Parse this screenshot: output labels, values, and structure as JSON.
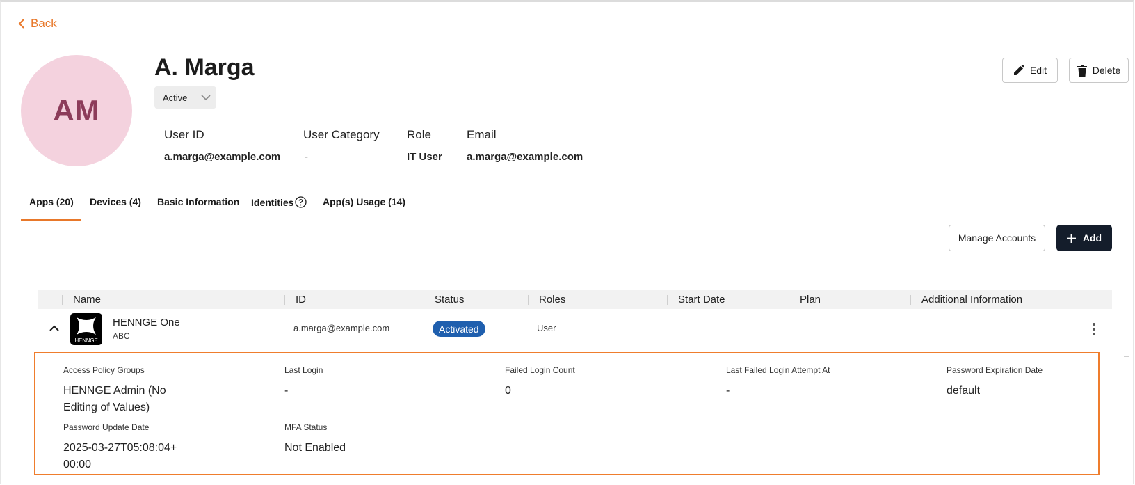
{
  "nav": {
    "back_label": "Back"
  },
  "user": {
    "initials": "AM",
    "name": "A. Marga",
    "status": "Active",
    "avatar_color": "#f4d2de",
    "avatar_text_color": "#8c3c5a"
  },
  "actions": {
    "edit_label": "Edit",
    "delete_label": "Delete"
  },
  "meta": [
    {
      "label": "User ID",
      "value": "a.marga@example.com"
    },
    {
      "label": "User Category",
      "value": "-"
    },
    {
      "label": "Role",
      "value": "IT User"
    },
    {
      "label": "Email",
      "value": "a.marga@example.com"
    }
  ],
  "tabs": [
    {
      "label": "Apps (20)",
      "active": true
    },
    {
      "label": "Devices (4)"
    },
    {
      "label": "Basic Information"
    },
    {
      "label": "Identities",
      "icon": "help-circle-icon"
    },
    {
      "label": "App(s) Usage (14)"
    }
  ],
  "toolbar": {
    "manage_label": "Manage Accounts",
    "add_label": "Add"
  },
  "table": {
    "columns": [
      "Name",
      "ID",
      "Status",
      "Roles",
      "Start Date",
      "Plan",
      "Additional Information"
    ],
    "rows": [
      {
        "app_name": "HENNGE One",
        "app_sub": "ABC",
        "app_logo_text": "HENNGE",
        "id": "a.marga@example.com",
        "status": "Activated",
        "roles": "User",
        "start_date": "",
        "plan": "",
        "additional_info": ""
      }
    ]
  },
  "details": [
    {
      "label": "Access Policy Groups",
      "value": "HENNGE Admin (No Editing of Values)"
    },
    {
      "label": "Last Login",
      "value": "-"
    },
    {
      "label": "Failed Login Count",
      "value": "0"
    },
    {
      "label": "Last Failed Login Attempt At",
      "value": "-"
    },
    {
      "label": "Password Expiration Date",
      "value": "default"
    },
    {
      "label": "Password Update Date",
      "value": "2025-03-27T05:08:04+00:00"
    },
    {
      "label": "MFA Status",
      "value": "Not Enabled"
    }
  ],
  "colors": {
    "accent": "#e8782a",
    "primary_button": "#141d2b",
    "badge": "#1f5fae",
    "detail_border": "#ef7d2d"
  }
}
